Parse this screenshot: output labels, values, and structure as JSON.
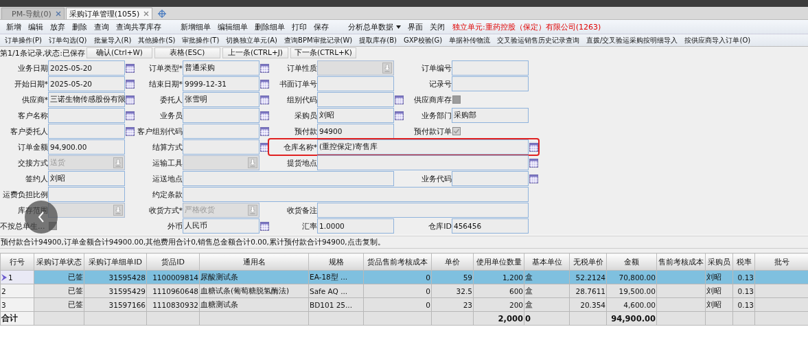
{
  "tabs": [
    {
      "label": "PM-导航(0)",
      "selected": false
    },
    {
      "label": "采购订单管理(1055)",
      "selected": true
    }
  ],
  "toolbar_groups": [
    [
      {
        "label": "新增",
        "kind": "button"
      },
      {
        "label": "编辑",
        "kind": "button"
      },
      {
        "label": "放弃",
        "kind": "button"
      },
      {
        "label": "删除",
        "kind": "button"
      },
      {
        "label": "查询",
        "kind": "button"
      },
      {
        "label": "查询共享库存",
        "kind": "button"
      }
    ],
    [
      {
        "label": "新增细单",
        "kind": "button"
      },
      {
        "label": "编辑细单",
        "kind": "button"
      },
      {
        "label": "删除细单",
        "kind": "button"
      },
      {
        "label": "打印",
        "kind": "button"
      },
      {
        "label": "保存",
        "kind": "button"
      }
    ],
    [
      {
        "label": "分析总单数据",
        "kind": "dropdown"
      },
      {
        "label": "界面",
        "kind": "button"
      },
      {
        "label": "关闭",
        "kind": "button"
      }
    ]
  ],
  "unit_notice": "独立单元:重药控股（保定）有限公司(1263)",
  "menu_bar": [
    "订单操作(P)",
    "订单勾选(Q)",
    "批量导入(R)",
    "其他操作(S)",
    "审批操作(T)",
    "切换独立单元(A)",
    "查询BPM审批记录(W)",
    "提取库存(B)",
    "GXP校验(G)",
    "单据补传物流",
    "交叉验运销售历史记录查询",
    "直拨/交叉验运采购按明细导入",
    "按供应商导入订单(O)"
  ],
  "record_bar": {
    "status": "第1/1条记录,状态:已保存",
    "buttons": [
      "确认(Ctrl+W)",
      "表格(ESC)",
      "上一条(CTRL+J)",
      "下一条(CTRL+K)"
    ]
  },
  "form_rows": [
    [
      {
        "label": "业务日期",
        "value": "2025-05-20",
        "kind": "lookup"
      },
      {
        "label": "订单类型*",
        "value": "普通采购",
        "kind": "lookup"
      },
      {
        "label": "订单性质",
        "kind": "select",
        "disabled": true
      },
      {
        "label": "订单编号",
        "kind": "text"
      }
    ],
    [
      {
        "label": "开始日期*",
        "value": "2025-05-20",
        "kind": "lookup"
      },
      {
        "label": "结束日期*",
        "value": "9999-12-31",
        "kind": "lookup"
      },
      {
        "label": "书面订单号",
        "kind": "text"
      },
      {
        "label": "记录号",
        "kind": "text"
      }
    ],
    [
      {
        "label": "供应商*",
        "value": "三诺生物传感股份有限",
        "kind": "lookup"
      },
      {
        "label": "委托人",
        "value": "张雪明",
        "kind": "lookup"
      },
      {
        "label": "组别代码",
        "kind": "lookup"
      },
      {
        "label": "供应商库存",
        "kind": "checkbox",
        "checked": false,
        "disabled": true
      }
    ],
    [
      {
        "label": "客户名称",
        "kind": "lookup"
      },
      {
        "label": "业务员",
        "kind": "lookup"
      },
      {
        "label": "采购员",
        "value": "刘昭",
        "kind": "lookup"
      },
      {
        "label": "业务部门",
        "value": "采购部",
        "kind": "text"
      }
    ],
    [
      {
        "label": "客户委托人",
        "kind": "lookup"
      },
      {
        "label": "客户组别代码",
        "kind": "lookup"
      },
      {
        "label": "预付款",
        "value": "94900",
        "kind": "text"
      },
      {
        "label": "预付款订单",
        "kind": "checkbox",
        "checked": true,
        "disabled": true
      }
    ],
    [
      {
        "label": "订单金额",
        "value": "94,900.00",
        "kind": "text"
      },
      {
        "label": "结算方式",
        "kind": "lookup"
      },
      {
        "label": "仓库名称*",
        "value": "(重控保定)寄售库",
        "kind": "lookup",
        "wide": true,
        "highlighted": true
      }
    ],
    [
      {
        "label": "交接方式",
        "value": "送货",
        "kind": "select",
        "disabled": true
      },
      {
        "label": "运输工具",
        "kind": "select",
        "disabled": true
      },
      {
        "label": "提货地点",
        "kind": "lookup",
        "wide": true
      }
    ],
    [
      {
        "label": "签约人",
        "value": "刘昭",
        "kind": "text"
      },
      {
        "label": "运送地点",
        "kind": "text",
        "wide": true
      },
      {
        "label": "业务代码",
        "kind": "lookup"
      }
    ],
    [
      {
        "label": "运费负担比例",
        "kind": "text"
      },
      {
        "label": "约定条款",
        "kind": "text",
        "wide": true
      }
    ],
    [
      {
        "label": "库存范围",
        "kind": "select",
        "disabled": true
      },
      {
        "label": "收货方式*",
        "value": "严格收货",
        "kind": "select",
        "disabled": true
      },
      {
        "label": "收货备注",
        "kind": "text",
        "wide": true
      }
    ],
    [
      {
        "label": "不按总单生...",
        "kind": "checkbox",
        "checked": false,
        "disabled": true
      },
      {
        "label": "外币",
        "value": "人民币",
        "kind": "lookup"
      },
      {
        "label": "汇率",
        "value": "1.0000",
        "kind": "text"
      },
      {
        "label": "仓库ID",
        "value": "456456",
        "kind": "text"
      }
    ]
  ],
  "summary": "预付款合计94900,订单金额合计94900.00,其他费用合计0,销售总金额合计0.00,累计预付款合计94900,点击复制。",
  "table": {
    "columns": [
      {
        "label": "行号",
        "kind": "text"
      },
      {
        "label": "采购订单状态",
        "kind": "number"
      },
      {
        "label": "采购订单细单ID",
        "kind": "number"
      },
      {
        "label": "货品ID",
        "kind": "number"
      },
      {
        "label": "通用名",
        "kind": "text"
      },
      {
        "label": "规格",
        "kind": "text"
      },
      {
        "label": "货品售前考核成本",
        "kind": "number"
      },
      {
        "label": "单价",
        "kind": "number"
      },
      {
        "label": "使用单位数量",
        "kind": "number"
      },
      {
        "label": "基本单位",
        "kind": "text"
      },
      {
        "label": "无税单价",
        "kind": "number"
      },
      {
        "label": "金额",
        "kind": "number"
      },
      {
        "label": "售前考核成本",
        "kind": "number"
      },
      {
        "label": "采购员",
        "kind": "text"
      },
      {
        "label": "税率",
        "kind": "number"
      },
      {
        "label": "批号",
        "kind": "text"
      }
    ],
    "rows": [
      {
        "selected": true,
        "cells": [
          "1",
          "已签",
          "31595428",
          "1100009814",
          "尿酸测试条",
          "EA-18型 ...",
          "0",
          "59",
          "1,200",
          "盒",
          "52.2124",
          "70,800.00",
          null,
          "刘昭",
          "0.13",
          null
        ]
      },
      {
        "selected": false,
        "cells": [
          "2",
          "已签",
          "31595429",
          "1110960648",
          "血糖试条(葡萄糖脱氢酶法)",
          "Safe AQ ...",
          "0",
          "32.5",
          "600",
          "盒",
          "28.7611",
          "19,500.00",
          null,
          "刘昭",
          "0.13",
          null
        ]
      },
      {
        "selected": false,
        "cells": [
          "3",
          "已签",
          "31597166",
          "1110830932",
          "血糖测试条",
          "BD101 25...",
          "0",
          "23",
          "200",
          "盒",
          "20.354",
          "4,600.00",
          null,
          "刘昭",
          "0.13",
          null
        ]
      }
    ],
    "total": {
      "label": "合计",
      "cells": [
        null,
        null,
        null,
        null,
        null,
        null,
        null,
        "2,000",
        "0",
        null,
        "94,900.00",
        null,
        null,
        null,
        null
      ]
    }
  }
}
